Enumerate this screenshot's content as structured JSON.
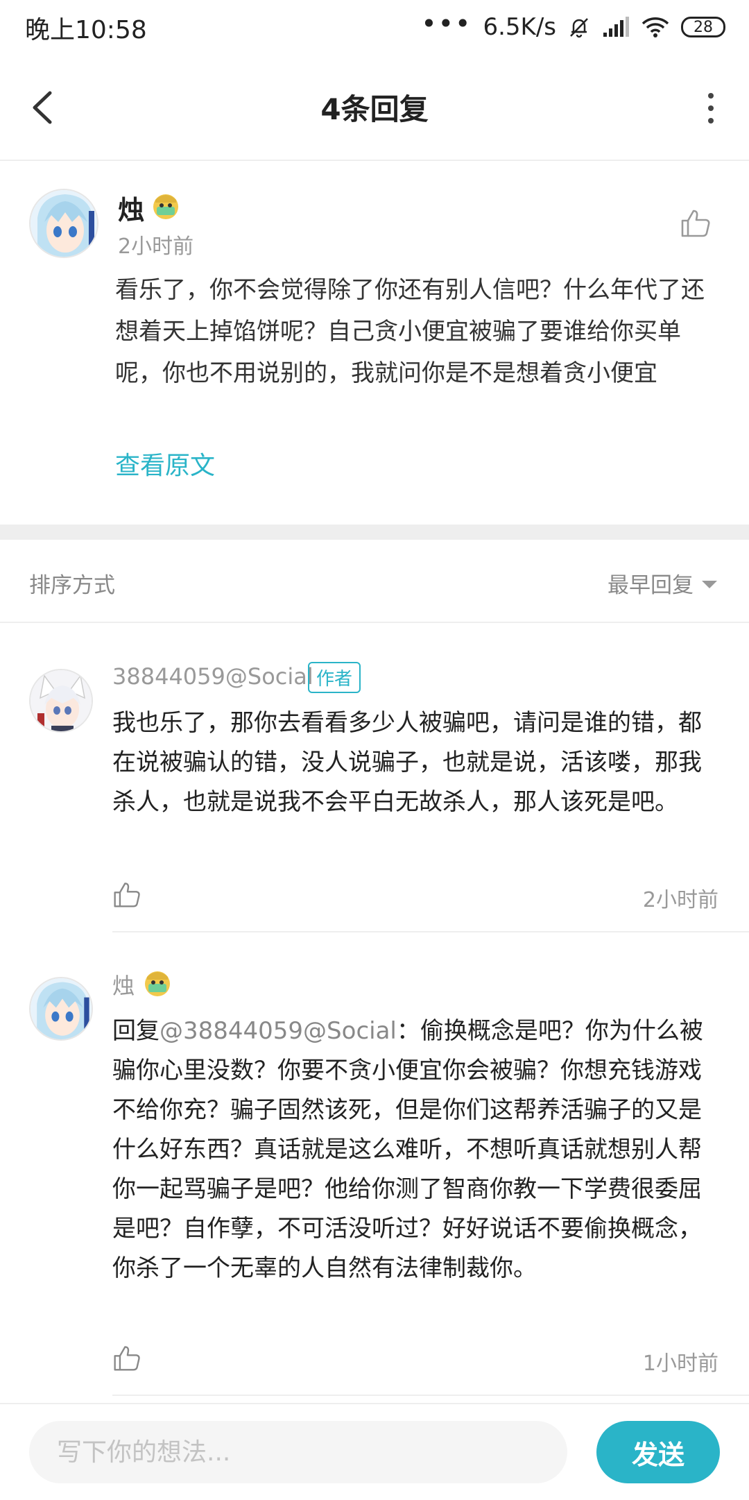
{
  "status_bar": {
    "time": "晚上10:58",
    "dots": "•••",
    "network_speed": "6.5K/s",
    "battery": "28"
  },
  "header": {
    "title": "4条回复"
  },
  "original_comment": {
    "author": "烛",
    "time": "2小时前",
    "content": "看乐了，你不会觉得除了你还有别人信吧？什么年代了还想着天上掉馅饼呢？自己贪小便宜被骗了要谁给你买单呢，你也不用说别的，我就问你是不是想着贪小便宜",
    "view_original_label": "查看原文"
  },
  "sort": {
    "label": "排序方式",
    "selected": "最早回复"
  },
  "replies": [
    {
      "author": "38844059@Social",
      "tag": "作者",
      "content": "我也乐了，那你去看看多少人被骗吧，请问是谁的错，都在说被骗认的错，没人说骗子，也就是说，活该喽，那我杀人，也就是说我不会平白无故杀人，那人该死是吧。",
      "time": "2小时前"
    },
    {
      "author": "烛",
      "reply_prefix": "回复",
      "reply_to": "@38844059@Social",
      "colon": "：",
      "content": "偷换概念是吧？你为什么被骗你心里没数？你要不贪小便宜你会被骗？你想充钱游戏不给你充？骗子固然该死，但是你们这帮养活骗子的又是什么好东西？真话就是这么难听，不想听真话就想别人帮你一起骂骗子是吧？他给你测了智商你教一下学费很委屈是吧？自作孽，不可活没听过？好好说话不要偷换概念，你杀了一个无辜的人自然有法律制裁你。",
      "time": "1小时前"
    }
  ],
  "composer": {
    "placeholder": "写下你的想法...",
    "send_label": "发送"
  },
  "colors": {
    "accent": "#2ab4c8",
    "divider": "#eeeeee",
    "secondary_text": "#999999"
  }
}
